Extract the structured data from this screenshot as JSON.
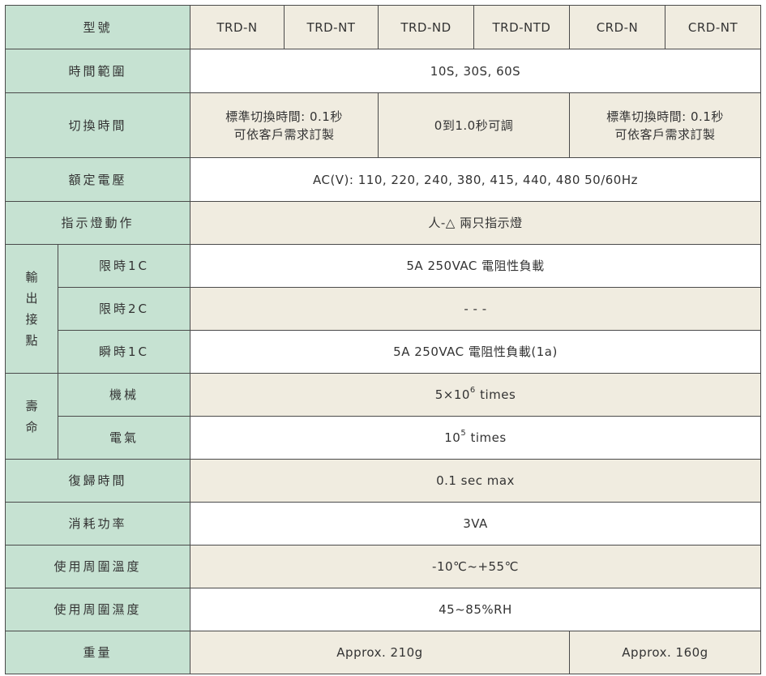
{
  "table": {
    "header": {
      "label": "型號",
      "models": [
        "TRD-N",
        "TRD-NT",
        "TRD-ND",
        "TRD-NTD",
        "CRD-N",
        "CRD-NT"
      ]
    },
    "time_range": {
      "label": "時間範圍",
      "value": "10S, 30S, 60S"
    },
    "switch_time": {
      "label": "切換時間",
      "left": "標準切換時間: 0.1秒\n可依客戶需求訂製",
      "middle": "0到1.0秒可調",
      "right": "標準切換時間: 0.1秒\n可依客戶需求訂製"
    },
    "rated_voltage": {
      "label": "額定電壓",
      "value": "AC(V): 110, 220, 240, 380, 415, 440, 480  50/60Hz"
    },
    "indicator": {
      "label": "指示燈動作",
      "value": "人-△  兩只指示燈"
    },
    "output": {
      "group_label": "輸出接點",
      "rows": [
        {
          "label": "限時1C",
          "value": "5A 250VAC 電阻性負載"
        },
        {
          "label": "限時2C",
          "value": "- - -"
        },
        {
          "label": "瞬時1C",
          "value": "5A 250VAC 電阻性負載(1a)"
        }
      ]
    },
    "life": {
      "group_label": "壽命",
      "mechanical": {
        "label": "機械",
        "base": "5×10",
        "exp": "6",
        "unit": " times"
      },
      "electrical": {
        "label": "電氣",
        "base": "10",
        "exp": "5",
        "unit": " times"
      }
    },
    "reset_time": {
      "label": "復歸時間",
      "value": "0.1 sec max"
    },
    "power_consumption": {
      "label": "消耗功率",
      "value": "3VA"
    },
    "ambient_temp": {
      "label": "使用周圍溫度",
      "value": "-10℃~+55℃"
    },
    "ambient_humidity": {
      "label": "使用周圍濕度",
      "value": "45~85%RH"
    },
    "weight": {
      "label": "重量",
      "trd": "Approx. 210g",
      "crd": "Approx. 160g"
    }
  }
}
